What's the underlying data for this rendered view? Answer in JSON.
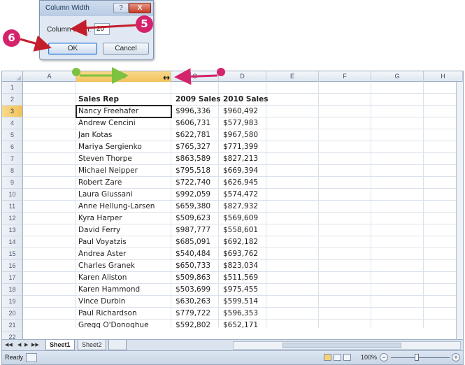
{
  "dialog": {
    "title": "Column Width",
    "help_label": "?",
    "close_label": "X",
    "field_label": "Column width:",
    "field_value": "20",
    "ok_label": "OK",
    "cancel_label": "Cancel"
  },
  "callouts": {
    "step5": "5",
    "step6": "6",
    "color": "#d5236b"
  },
  "sheet": {
    "columns": [
      "A",
      "B",
      "C",
      "D",
      "E",
      "F",
      "G",
      "H"
    ],
    "selected_column": "B",
    "active_row": "3",
    "row_numbers": [
      "1",
      "2",
      "3",
      "4",
      "5",
      "6",
      "7",
      "8",
      "9",
      "10",
      "11",
      "12",
      "13",
      "14",
      "15",
      "16",
      "17",
      "18",
      "19",
      "20",
      "21",
      "22"
    ],
    "table": {
      "headers": [
        "Sales Rep",
        "2009 Sales",
        "2010 Sales"
      ],
      "rows": [
        [
          "Nancy Freehafer",
          "$996,336",
          "$960,492"
        ],
        [
          "Andrew Cencini",
          "$606,731",
          "$577,983"
        ],
        [
          "Jan Kotas",
          "$622,781",
          "$967,580"
        ],
        [
          "Mariya Sergienko",
          "$765,327",
          "$771,399"
        ],
        [
          "Steven Thorpe",
          "$863,589",
          "$827,213"
        ],
        [
          "Michael Neipper",
          "$795,518",
          "$669,394"
        ],
        [
          "Robert Zare",
          "$722,740",
          "$626,945"
        ],
        [
          "Laura Giussani",
          "$992,059",
          "$574,472"
        ],
        [
          "Anne Hellung-Larsen",
          "$659,380",
          "$827,932"
        ],
        [
          "Kyra Harper",
          "$509,623",
          "$569,609"
        ],
        [
          "David Ferry",
          "$987,777",
          "$558,601"
        ],
        [
          "Paul Voyatzis",
          "$685,091",
          "$692,182"
        ],
        [
          "Andrea Aster",
          "$540,484",
          "$693,762"
        ],
        [
          "Charles Granek",
          "$650,733",
          "$823,034"
        ],
        [
          "Karen Aliston",
          "$509,863",
          "$511,569"
        ],
        [
          "Karen Hammond",
          "$503,699",
          "$975,455"
        ],
        [
          "Vince Durbin",
          "$630,263",
          "$599,514"
        ],
        [
          "Paul Richardson",
          "$779,722",
          "$596,353"
        ],
        [
          "Gregg O'Donoghue",
          "$592,802",
          "$652,171"
        ]
      ]
    },
    "tabs": {
      "sheet1": "Sheet1",
      "sheet2": "Sheet2"
    }
  },
  "status_bar": {
    "status": "Ready",
    "zoom": "100%",
    "zoom_out": "−",
    "zoom_in": "+"
  },
  "colors": {
    "selection": "#f1c25b",
    "arrow_green": "#7cc23f",
    "arrow_magenta": "#d5236b"
  }
}
